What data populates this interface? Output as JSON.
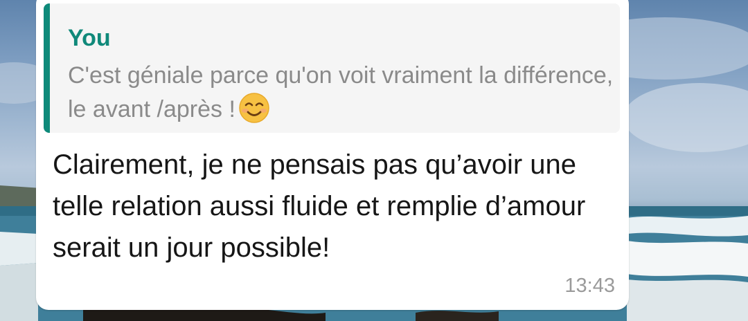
{
  "message": {
    "quoted": {
      "author": "You",
      "text": "C'est géniale parce qu'on voit vraiment la différence, le avant /après !",
      "emoji": "smiling-face-with-smiling-eyes-icon"
    },
    "text": "Clairement, je ne pensais pas qu’avoir une telle relation aussi fluide et remplie d’amour serait un jour possible!",
    "time": "13:43"
  },
  "colors": {
    "accent": "#0e8a7a",
    "author": "#10897a",
    "quote_text": "#8a8a8a",
    "message_text": "#161616",
    "timestamp": "#9a9a9a",
    "bubble_bg": "#ffffff",
    "quote_bg": "#f5f5f5"
  }
}
